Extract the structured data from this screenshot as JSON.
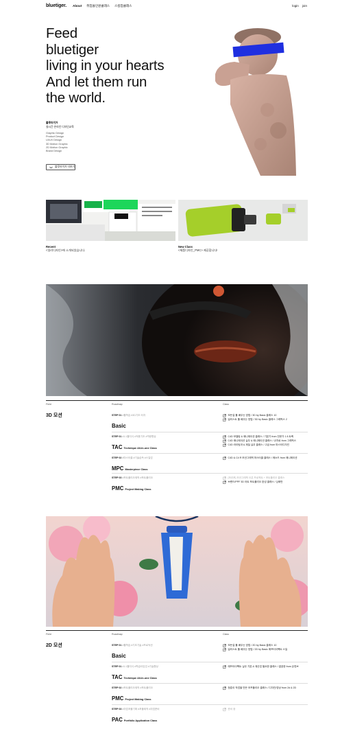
{
  "header": {
    "logo": "bluetiger.",
    "nav": [
      "About",
      "취업올인원클래스",
      "스킬업클래스"
    ],
    "auth": [
      "login",
      "join"
    ]
  },
  "hero": {
    "title_lines": [
      "Feed",
      "bluetiger",
      "living in your hearts",
      "And let them run",
      "the world."
    ],
    "intro_1": "블루타이거",
    "intro_2": "실시간·온라인 디자인교육",
    "subjects": [
      "Graphic Design",
      "Product Design",
      "UI/UX Design",
      "3D Motion Graphic",
      "2D Motion Graphic",
      "Brand Design"
    ],
    "more_button": "블루타이거 더보기"
  },
  "cards": [
    {
      "title": "Recent",
      "subtitle": "<일리디자인>에 소개되었습니다."
    },
    {
      "title": "New Class",
      "subtitle": "<제품디자인_PMC> 제공합니다!"
    }
  ],
  "sections": [
    {
      "headers": {
        "field": "Field",
        "roadmap": "Roadmap",
        "class": "Class"
      },
      "field": "3D 모션",
      "steps": [
        {
          "label": "STEP 01",
          "tags": "#툴학습 #3D기초·타자",
          "name": "Basic",
          "sub": "",
          "classes": [
            {
              "text": "모든걸 툴 배우는 방법 / 3D by Basic 클래스 10",
              "dim": false
            },
            {
              "text": "일러스트 툴 배우는 방법 / 3D by Basic 클래스 그래픽스 2",
              "dim": false
            }
          ]
        },
        {
          "label": "STEP 01",
          "tags": "#1:1툴지식 #적용기초 #역량향상",
          "name": "TAC",
          "sub": "Technique All-In-one Class",
          "classes": [
            {
              "text": "C4D 모델링 & 애니메이션 클래스 / 기본기 from 전문가 1 8 트랙",
              "dim": false
            },
            {
              "text": "C4D 애니메이션 실무 & 애니메이션 클래스 / 교차로 from 그래픽스",
              "dim": false
            },
            {
              "text": "C4D 라이팅과 & 재질 실무 클래스 / 고급 from 마스터디자인",
              "dim": false
            }
          ]
        },
        {
          "label": "STEP 02",
          "tags": "#마스터클 #기술습득 #스킬업",
          "name": "MPC",
          "sub": "Masterpiece Class",
          "classes": [
            {
              "text": "C4D & C4 R 모션그래픽 마스터클 클래스 / 메소드 from 애니메이션",
              "dim": false
            }
          ]
        },
        {
          "label": "STEP 03",
          "tags": "#포트폴리오제작 #포트폴리오",
          "name": "PMC",
          "sub": "Project Making Class",
          "classes": [
            {
              "text": "[모션포] 모션그래픽 오픈 프로젝트 + 포트폴리오 클래스",
              "dim": true
            },
            {
              "text": "브랜드/PPF 3D 아트 포트폴리오 완성 클래스 / 심화반",
              "dim": false
            }
          ]
        }
      ]
    },
    {
      "headers": {
        "field": "Field",
        "roadmap": "Roadmap",
        "class": "Class"
      },
      "field": "2D 모션",
      "steps": [
        {
          "label": "STEP 01",
          "tags": "#툴학습 #기초기술 #프로덕션",
          "name": "Basic",
          "sub": "",
          "classes": [
            {
              "text": "모든걸 툴 배우는 방법 / 2D by Basic 클래스 10",
              "dim": false
            },
            {
              "text": "일러스트 툴 배우는 방법 / 2D by Basic 에프터이펙트 스킬",
              "dim": false
            }
          ]
        },
        {
          "label": "STEP 01",
          "tags": "#1:1툴지식 #학습타임업 #기술향상",
          "name": "TAC",
          "sub": "Technique All-In-one Class",
          "classes": [
            {
              "text": "에프터이펙트 실무 기본 & 재산업 필요한 클래스 / 깔끔한 from 유튜브",
              "dim": false
            }
          ]
        },
        {
          "label": "STEP 02",
          "tags": "#포트폴리오제작 #포트폴리오",
          "name": "PMC",
          "sub": "Project Making Class",
          "classes": [
            {
              "text": "청춘이 작업을 만든 모프폴리오 클래스 / 디자인/영상 from 2d & 2D",
              "dim": false
            }
          ]
        },
        {
          "label": "STEP 03",
          "tags": "#취업포폴기획 #포폴제작 #취업준비",
          "name": "PAC",
          "sub": "Portfolio Application Class",
          "classes": [
            {
              "text": "준비 중",
              "dim": true
            }
          ]
        }
      ]
    }
  ]
}
